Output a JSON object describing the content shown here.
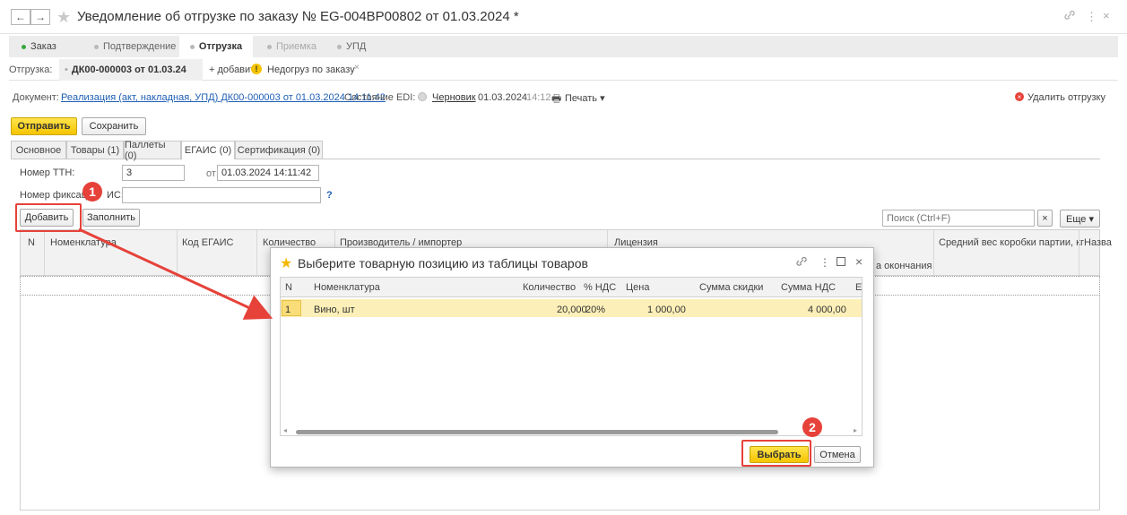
{
  "window": {
    "title": "Уведомление об отгрузке по заказу № EG-004BP00802 от 01.03.2024 *",
    "back": "←",
    "forward": "→"
  },
  "steps": [
    {
      "label": "Заказ",
      "color": "#3aa83a"
    },
    {
      "label": "Подтверждение",
      "color": "#b0b0b0"
    },
    {
      "label": "Отгрузка",
      "color": "#b0b0b0"
    },
    {
      "label": "Приемка",
      "color": "#b0b0b0"
    },
    {
      "label": "УПД",
      "color": "#b0b0b0"
    }
  ],
  "shipments": {
    "label": "Отгрузка:",
    "active": "ДК00-000003 от 01.03.24",
    "add": "+ добавить",
    "warning": "Недогруз по заказу",
    "warning_close": "×"
  },
  "docline": {
    "label": "Документ:",
    "doc_link": "Реализация (акт, накладная, УПД) ДК00-000003 от 01.03.2024 14:11:42",
    "edi_label": "Состояние EDI:",
    "edi_status": "Черновик",
    "edi_date": "01.03.2024",
    "edi_time": "14:12",
    "print": "Печать ▾",
    "delete": "Удалить отгрузку"
  },
  "actions": {
    "send": "Отправить",
    "save": "Сохранить"
  },
  "form_tabs": [
    "Основное",
    "Товары (1)",
    "Паллеты (0)",
    "ЕГАИС (0)",
    "Сертификация (0)"
  ],
  "ttn": {
    "label": "Номер ТТН:",
    "value": "3",
    "from_label": "от:",
    "from_value": "01.03.2024 14:11:42"
  },
  "fix": {
    "label_left": "Номер фиксации",
    "label_right": "ИС:",
    "value": "",
    "help": "?"
  },
  "table_toolbar": {
    "add": "Добавить",
    "fill": "Заполнить",
    "search_placeholder": "Поиск (Ctrl+F)",
    "clear": "×",
    "more": "Еще ▾"
  },
  "grid_columns": [
    "N",
    "Номенклатура",
    "Код ЕГАИС",
    "Количество",
    "Производитель / импортер",
    "Лицензия",
    "а окончания",
    "Средний вес коробки партии, кг",
    "Назва"
  ],
  "modal": {
    "title": "Выберите товарную позицию из таблицы товаров",
    "columns": [
      "N",
      "Номенклатура",
      "Количество",
      "% НДС",
      "Цена",
      "Сумма скидки",
      "Сумма НДС",
      "Е"
    ],
    "rows": [
      {
        "n": "1",
        "name": "Вино, шт",
        "qty": "20,000",
        "vat": "20%",
        "price": "1 000,00",
        "discount": "",
        "vat_sum": "4 000,00"
      }
    ],
    "select": "Выбрать",
    "cancel": "Отмена"
  },
  "annotations": {
    "step1": "1",
    "step2": "2"
  }
}
